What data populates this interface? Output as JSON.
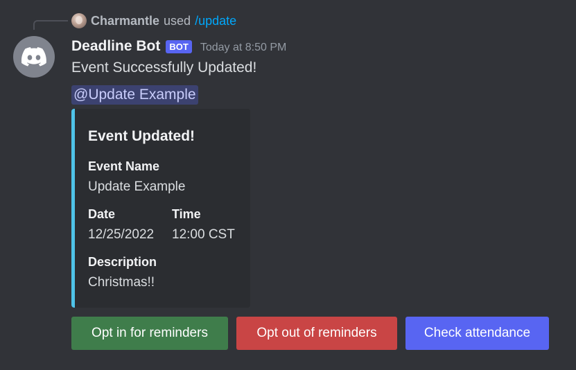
{
  "reply": {
    "username": "Charmantle",
    "used_text": "used",
    "command": "/update",
    "avatar_icon": "user-avatar-icon"
  },
  "message": {
    "bot_name": "Deadline Bot",
    "bot_tag": "BOT",
    "timestamp": "Today at 8:50 PM",
    "content": "Event Successfully Updated!",
    "mention": "@Update Example",
    "avatar_icon": "discord-logo-icon"
  },
  "embed": {
    "accent_color": "#4fc3e8",
    "title": "Event Updated!",
    "fields": {
      "event_name": {
        "name": "Event Name",
        "value": "Update Example"
      },
      "date": {
        "name": "Date",
        "value": "12/25/2022"
      },
      "time": {
        "name": "Time",
        "value": "12:00 CST"
      },
      "description": {
        "name": "Description",
        "value": "Christmas!!"
      }
    }
  },
  "buttons": {
    "opt_in": {
      "label": "Opt in for reminders",
      "color": "#3f7d4b"
    },
    "opt_out": {
      "label": "Opt out of reminders",
      "color": "#c94545"
    },
    "attendance": {
      "label": "Check attendance",
      "color": "#5865f2"
    }
  }
}
